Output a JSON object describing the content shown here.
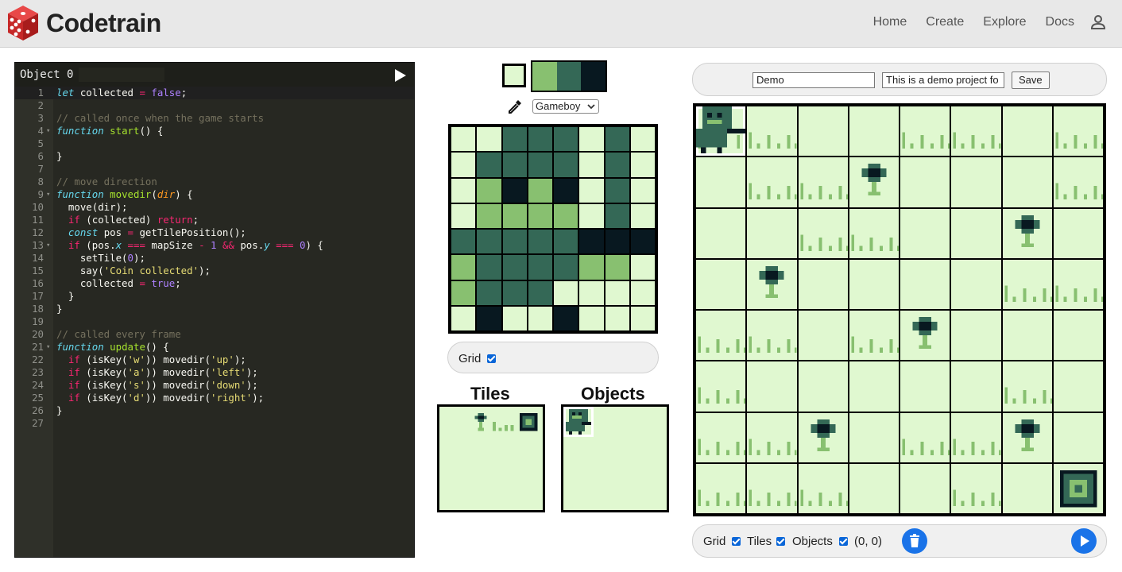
{
  "app": {
    "name": "Codetrain"
  },
  "nav": [
    {
      "label": "Home"
    },
    {
      "label": "Create"
    },
    {
      "label": "Explore"
    },
    {
      "label": "Docs"
    }
  ],
  "editor": {
    "object_name": "Object 0",
    "lines": [
      {
        "n": "1",
        "t": "let collected = false;"
      },
      {
        "n": "2",
        "t": ""
      },
      {
        "n": "3",
        "t": "// called once when the game starts"
      },
      {
        "n": "4",
        "t": "function start() {"
      },
      {
        "n": "5",
        "t": ""
      },
      {
        "n": "6",
        "t": "}"
      },
      {
        "n": "7",
        "t": ""
      },
      {
        "n": "8",
        "t": "// move direction"
      },
      {
        "n": "9",
        "t": "function movedir(dir) {"
      },
      {
        "n": "10",
        "t": "  move(dir);"
      },
      {
        "n": "11",
        "t": "  if (collected) return;"
      },
      {
        "n": "12",
        "t": "  const pos = getTilePosition();"
      },
      {
        "n": "13",
        "t": "  if (pos.x === mapSize - 1 && pos.y === 0) {"
      },
      {
        "n": "14",
        "t": "    setTile(0);"
      },
      {
        "n": "15",
        "t": "    say('Coin collected');"
      },
      {
        "n": "16",
        "t": "    collected = true;"
      },
      {
        "n": "17",
        "t": "  }"
      },
      {
        "n": "18",
        "t": "}"
      },
      {
        "n": "19",
        "t": ""
      },
      {
        "n": "20",
        "t": "// called every frame"
      },
      {
        "n": "21",
        "t": "function update() {"
      },
      {
        "n": "22",
        "t": "  if (isKey('w')) movedir('up');"
      },
      {
        "n": "23",
        "t": "  if (isKey('a')) movedir('left');"
      },
      {
        "n": "24",
        "t": "  if (isKey('s')) movedir('down');"
      },
      {
        "n": "25",
        "t": "  if (isKey('d')) movedir('right');"
      },
      {
        "n": "26",
        "t": "}"
      },
      {
        "n": "27",
        "t": ""
      }
    ]
  },
  "palette": {
    "selected_color": "#e0f8d0",
    "colors": [
      "#88c070",
      "#346856",
      "#081820"
    ],
    "selected_palette": "Gameboy"
  },
  "sprite_editor": {
    "grid_label": "Grid",
    "pixels": [
      [
        0,
        0,
        2,
        2,
        2,
        0,
        2,
        0
      ],
      [
        0,
        2,
        2,
        2,
        2,
        0,
        2,
        0
      ],
      [
        0,
        1,
        3,
        1,
        3,
        0,
        2,
        0
      ],
      [
        0,
        1,
        1,
        1,
        1,
        0,
        2,
        0
      ],
      [
        2,
        2,
        2,
        2,
        2,
        3,
        3,
        3
      ],
      [
        1,
        2,
        2,
        2,
        2,
        1,
        1,
        0
      ],
      [
        1,
        2,
        2,
        2,
        0,
        0,
        0,
        0
      ],
      [
        0,
        3,
        0,
        0,
        3,
        0,
        0,
        0
      ]
    ]
  },
  "panels": {
    "tiles_title": "Tiles",
    "objects_title": "Objects"
  },
  "project": {
    "title": "Demo",
    "description": "This is a demo project fo",
    "save_label": "Save"
  },
  "map": {
    "rows": [
      [
        "P",
        "G",
        "E",
        "E",
        "G",
        "G",
        "E",
        "G"
      ],
      [
        "E",
        "G",
        "G",
        "F",
        "E",
        "E",
        "E",
        "G"
      ],
      [
        "E",
        "E",
        "G",
        "G",
        "E",
        "E",
        "F",
        "E"
      ],
      [
        "E",
        "F",
        "E",
        "E",
        "E",
        "E",
        "G",
        "G"
      ],
      [
        "G",
        "G",
        "E",
        "G",
        "F",
        "E",
        "E",
        "E"
      ],
      [
        "G",
        "E",
        "E",
        "E",
        "E",
        "E",
        "G",
        "E"
      ],
      [
        "G",
        "G",
        "F",
        "E",
        "G",
        "G",
        "F",
        "E"
      ],
      [
        "G",
        "G",
        "G",
        "E",
        "E",
        "G",
        "E",
        "C"
      ]
    ]
  },
  "map_toolbar": {
    "grid_label": "Grid",
    "tiles_label": "Tiles",
    "objects_label": "Objects",
    "coords": "(0, 0)"
  }
}
